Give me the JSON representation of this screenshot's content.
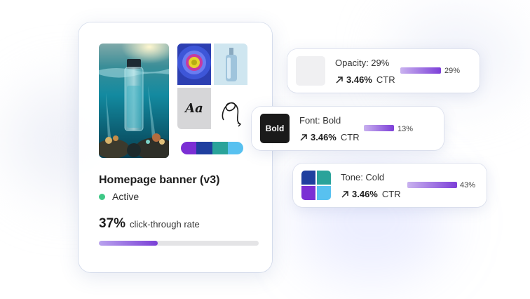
{
  "creative": {
    "title": "Homepage banner (v3)",
    "status": "Active",
    "status_color": "#3ec886",
    "ctr_value": "37%",
    "ctr_label": "click-through rate",
    "ctr_fraction": 0.37,
    "progress_color": "#7a3fd6",
    "type_sample": "Aa",
    "palette": [
      "#7b2fd4",
      "#1f3f9f",
      "#2aa39a",
      "#58c1f0"
    ]
  },
  "variants": [
    {
      "id": "opacity",
      "label": "Opacity: 29%",
      "ctr": "3.46%",
      "ctr_suffix": "CTR",
      "percent_label": "29%",
      "percent": 29,
      "thumb_color": "#f0f0f2"
    },
    {
      "id": "font",
      "label": "Font: Bold",
      "ctr": "3.46%",
      "ctr_suffix": "CTR",
      "percent_label": "13%",
      "percent": 13,
      "thumb_text": "Bold",
      "thumb_color": "#1a1a1a"
    },
    {
      "id": "tone",
      "label": "Tone: Cold",
      "ctr": "3.46%",
      "ctr_suffix": "CTR",
      "percent_label": "43%",
      "percent": 43,
      "thumb_colors": [
        "#1f3f9f",
        "#2aa39a",
        "#7b2fd4",
        "#58c1f0"
      ]
    }
  ],
  "icons": {
    "trend": "arrow-up-right-icon",
    "status": "status-dot-icon"
  }
}
